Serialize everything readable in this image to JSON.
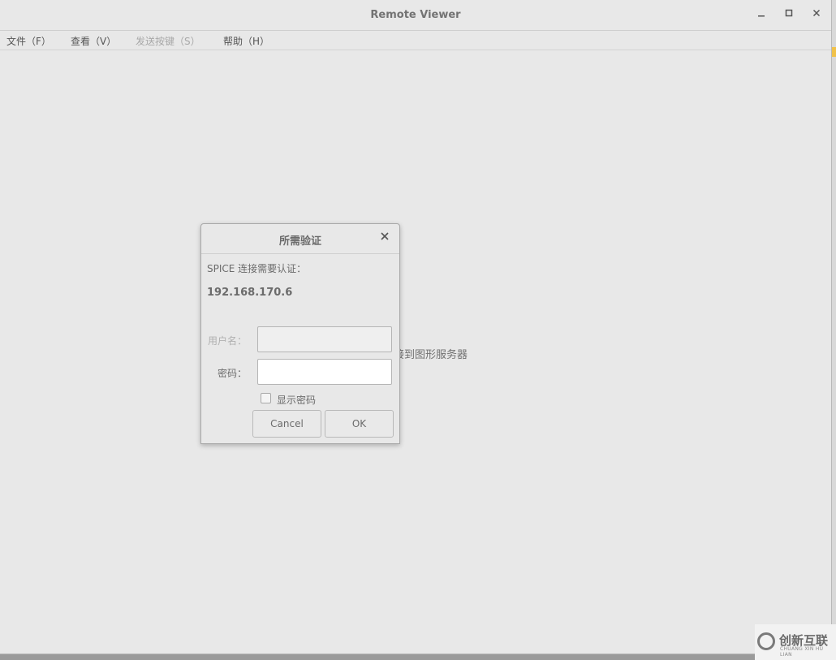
{
  "window": {
    "title": "Remote Viewer",
    "controls": {
      "minimize": "–",
      "maximize": "□",
      "close": "✕"
    }
  },
  "menu": [
    {
      "label": "文件（F）",
      "enabled": true
    },
    {
      "label": "查看（V）",
      "enabled": true
    },
    {
      "label": "发送按键（S）",
      "enabled": false
    },
    {
      "label": "帮助（H）",
      "enabled": true
    }
  ],
  "background_message": "接到图形服务器",
  "dialog": {
    "title": "所需验证",
    "close": "✕",
    "prompt": "SPICE 连接需要认证：",
    "host": "192.168.170.6",
    "username_label": "用户名：",
    "username_value": "",
    "password_label": "密码：",
    "password_value": "",
    "show_password_label": "显示密码",
    "show_password_checked": false,
    "cancel_label": "Cancel",
    "ok_label": "OK"
  },
  "watermark": {
    "text": "创新互联",
    "subtext": "CHUANG XIN HU LIAN"
  },
  "colors": {
    "window_bg": "#e8e8e8",
    "text": "#6e6e6e",
    "disabled_text": "#a8a8a8"
  }
}
